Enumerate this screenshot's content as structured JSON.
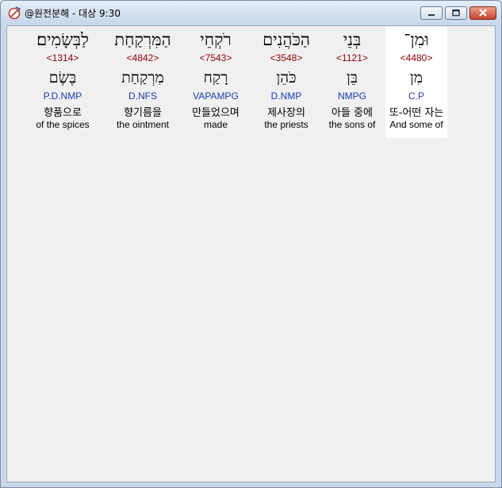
{
  "window": {
    "title": "@원전분해 - 대상 9:30"
  },
  "words": [
    {
      "hebrew": "וּמִן־",
      "strong": "<4480>",
      "lemma": "מִן",
      "morph": "C.P",
      "korean": "또-어떤 자는",
      "english": "And some of",
      "selected": true
    },
    {
      "hebrew": "בְּנֵי",
      "strong": "<1121>",
      "lemma": "בֵּן",
      "morph": "NMPG",
      "korean": "아들 중에",
      "english": "the sons of",
      "selected": false
    },
    {
      "hebrew": "הַכֹּהֲנִים",
      "strong": "<3548>",
      "lemma": "כֹּהֵן",
      "morph": "D.NMP",
      "korean": "제사장의",
      "english": "the priests",
      "selected": false
    },
    {
      "hebrew": "רֹקְחֵי",
      "strong": "<7543>",
      "lemma": "רָקַח",
      "morph": "VAPAMPG",
      "korean": "만들었으며",
      "english": "made",
      "selected": false
    },
    {
      "hebrew": "הַמִּרְקַחַת",
      "strong": "<4842>",
      "lemma": "מִרְקַחַת",
      "morph": "D.NFS",
      "korean": "향기름을",
      "english": "the ointment",
      "selected": false
    },
    {
      "hebrew": "לַבְּשָׂמִים׃",
      "strong": "<1314>",
      "lemma": "בֶּשֶׂם",
      "morph": "P.D.NMP",
      "korean": "향품으로",
      "english": "of the spices",
      "selected": false
    }
  ]
}
